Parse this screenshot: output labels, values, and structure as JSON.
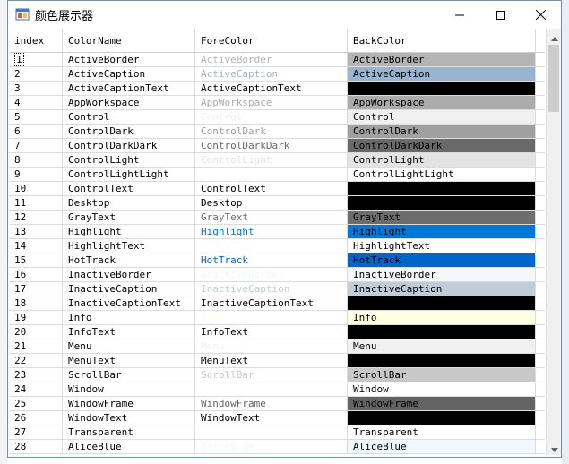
{
  "window": {
    "title": "颜色展示器"
  },
  "grid": {
    "headers": {
      "index": "index",
      "name": "ColorName",
      "fore": "ForeColor",
      "back": "BackColor"
    },
    "rows": [
      {
        "index": "1",
        "name": "ActiveBorder",
        "fore_color": "#b4b4b4",
        "back_color": "#b4b4b4",
        "back_text": "#000000"
      },
      {
        "index": "2",
        "name": "ActiveCaption",
        "fore_color": "#99b4d1",
        "back_color": "#99b4d1",
        "back_text": "#000000"
      },
      {
        "index": "3",
        "name": "ActiveCaptionText",
        "fore_color": "#000000",
        "back_color": "#000000",
        "back_text": "#000000"
      },
      {
        "index": "4",
        "name": "AppWorkspace",
        "fore_color": "#ababab",
        "back_color": "#ababab",
        "back_text": "#000000"
      },
      {
        "index": "5",
        "name": "Control",
        "fore_color": "#f0f0f0",
        "back_color": "#f0f0f0",
        "back_text": "#000000"
      },
      {
        "index": "6",
        "name": "ControlDark",
        "fore_color": "#a0a0a0",
        "back_color": "#a0a0a0",
        "back_text": "#000000"
      },
      {
        "index": "7",
        "name": "ControlDarkDark",
        "fore_color": "#696969",
        "back_color": "#696969",
        "back_text": "#000000"
      },
      {
        "index": "8",
        "name": "ControlLight",
        "fore_color": "#e3e3e3",
        "back_color": "#e3e3e3",
        "back_text": "#000000"
      },
      {
        "index": "9",
        "name": "ControlLightLight",
        "fore_color": "#ffffff",
        "back_color": "#ffffff",
        "back_text": "#000000"
      },
      {
        "index": "10",
        "name": "ControlText",
        "fore_color": "#000000",
        "back_color": "#000000",
        "back_text": "#000000"
      },
      {
        "index": "11",
        "name": "Desktop",
        "fore_color": "#000000",
        "back_color": "#000000",
        "back_text": "#000000"
      },
      {
        "index": "12",
        "name": "GrayText",
        "fore_color": "#6d6d6d",
        "back_color": "#6d6d6d",
        "back_text": "#000000"
      },
      {
        "index": "13",
        "name": "Highlight",
        "fore_color": "#0078d7",
        "back_color": "#0078d7",
        "back_text": "#000000"
      },
      {
        "index": "14",
        "name": "HighlightText",
        "fore_color": "#ffffff",
        "back_color": "#ffffff",
        "back_text": "#000000"
      },
      {
        "index": "15",
        "name": "HotTrack",
        "fore_color": "#0066cc",
        "back_color": "#0066cc",
        "back_text": "#000000"
      },
      {
        "index": "16",
        "name": "InactiveBorder",
        "fore_color": "#f4f7fc",
        "back_color": "#f4f7fc",
        "back_text": "#000000"
      },
      {
        "index": "17",
        "name": "InactiveCaption",
        "fore_color": "#bfcddb",
        "back_color": "#bfcddb",
        "back_text": "#000000"
      },
      {
        "index": "18",
        "name": "InactiveCaptionText",
        "fore_color": "#000000",
        "back_color": "#000000",
        "back_text": "#000000"
      },
      {
        "index": "19",
        "name": "Info",
        "fore_color": "#ffffe1",
        "back_color": "#ffffe1",
        "back_text": "#000000"
      },
      {
        "index": "20",
        "name": "InfoText",
        "fore_color": "#000000",
        "back_color": "#000000",
        "back_text": "#000000"
      },
      {
        "index": "21",
        "name": "Menu",
        "fore_color": "#f0f0f0",
        "back_color": "#f0f0f0",
        "back_text": "#000000"
      },
      {
        "index": "22",
        "name": "MenuText",
        "fore_color": "#000000",
        "back_color": "#000000",
        "back_text": "#000000"
      },
      {
        "index": "23",
        "name": "ScrollBar",
        "fore_color": "#c8c8c8",
        "back_color": "#c8c8c8",
        "back_text": "#000000"
      },
      {
        "index": "24",
        "name": "Window",
        "fore_color": "#ffffff",
        "back_color": "#ffffff",
        "back_text": "#000000"
      },
      {
        "index": "25",
        "name": "WindowFrame",
        "fore_color": "#646464",
        "back_color": "#646464",
        "back_text": "#000000"
      },
      {
        "index": "26",
        "name": "WindowText",
        "fore_color": "#000000",
        "back_color": "#000000",
        "back_text": "#000000"
      },
      {
        "index": "27",
        "name": "Transparent",
        "fore_color": "#ffffff",
        "back_color": "#ffffff",
        "back_text": "#000000"
      },
      {
        "index": "28",
        "name": "AliceBlue",
        "fore_color": "#f0f8ff",
        "back_color": "#f0f8ff",
        "back_text": "#000000"
      }
    ]
  },
  "icons": {
    "app": "app-icon",
    "minimize": "minimize-icon",
    "maximize": "maximize-icon",
    "close": "close-icon",
    "scroll_up": "chevron-up-icon",
    "scroll_down": "chevron-down-icon"
  }
}
